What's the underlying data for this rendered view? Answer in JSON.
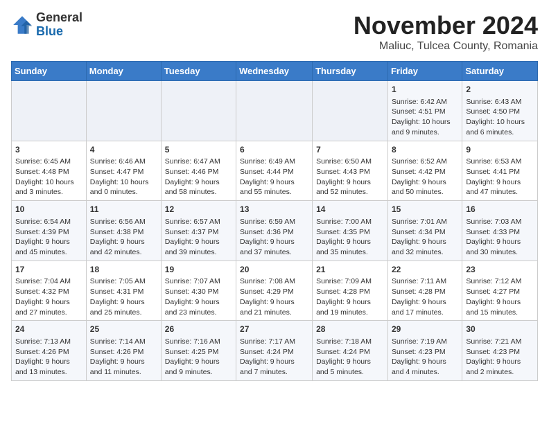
{
  "logo": {
    "general": "General",
    "blue": "Blue"
  },
  "title": "November 2024",
  "location": "Maliuc, Tulcea County, Romania",
  "days_of_week": [
    "Sunday",
    "Monday",
    "Tuesday",
    "Wednesday",
    "Thursday",
    "Friday",
    "Saturday"
  ],
  "weeks": [
    [
      {
        "day": "",
        "sunrise": "",
        "sunset": "",
        "daylight": ""
      },
      {
        "day": "",
        "sunrise": "",
        "sunset": "",
        "daylight": ""
      },
      {
        "day": "",
        "sunrise": "",
        "sunset": "",
        "daylight": ""
      },
      {
        "day": "",
        "sunrise": "",
        "sunset": "",
        "daylight": ""
      },
      {
        "day": "",
        "sunrise": "",
        "sunset": "",
        "daylight": ""
      },
      {
        "day": "1",
        "sunrise": "Sunrise: 6:42 AM",
        "sunset": "Sunset: 4:51 PM",
        "daylight": "Daylight: 10 hours and 9 minutes."
      },
      {
        "day": "2",
        "sunrise": "Sunrise: 6:43 AM",
        "sunset": "Sunset: 4:50 PM",
        "daylight": "Daylight: 10 hours and 6 minutes."
      }
    ],
    [
      {
        "day": "3",
        "sunrise": "Sunrise: 6:45 AM",
        "sunset": "Sunset: 4:48 PM",
        "daylight": "Daylight: 10 hours and 3 minutes."
      },
      {
        "day": "4",
        "sunrise": "Sunrise: 6:46 AM",
        "sunset": "Sunset: 4:47 PM",
        "daylight": "Daylight: 10 hours and 0 minutes."
      },
      {
        "day": "5",
        "sunrise": "Sunrise: 6:47 AM",
        "sunset": "Sunset: 4:46 PM",
        "daylight": "Daylight: 9 hours and 58 minutes."
      },
      {
        "day": "6",
        "sunrise": "Sunrise: 6:49 AM",
        "sunset": "Sunset: 4:44 PM",
        "daylight": "Daylight: 9 hours and 55 minutes."
      },
      {
        "day": "7",
        "sunrise": "Sunrise: 6:50 AM",
        "sunset": "Sunset: 4:43 PM",
        "daylight": "Daylight: 9 hours and 52 minutes."
      },
      {
        "day": "8",
        "sunrise": "Sunrise: 6:52 AM",
        "sunset": "Sunset: 4:42 PM",
        "daylight": "Daylight: 9 hours and 50 minutes."
      },
      {
        "day": "9",
        "sunrise": "Sunrise: 6:53 AM",
        "sunset": "Sunset: 4:41 PM",
        "daylight": "Daylight: 9 hours and 47 minutes."
      }
    ],
    [
      {
        "day": "10",
        "sunrise": "Sunrise: 6:54 AM",
        "sunset": "Sunset: 4:39 PM",
        "daylight": "Daylight: 9 hours and 45 minutes."
      },
      {
        "day": "11",
        "sunrise": "Sunrise: 6:56 AM",
        "sunset": "Sunset: 4:38 PM",
        "daylight": "Daylight: 9 hours and 42 minutes."
      },
      {
        "day": "12",
        "sunrise": "Sunrise: 6:57 AM",
        "sunset": "Sunset: 4:37 PM",
        "daylight": "Daylight: 9 hours and 39 minutes."
      },
      {
        "day": "13",
        "sunrise": "Sunrise: 6:59 AM",
        "sunset": "Sunset: 4:36 PM",
        "daylight": "Daylight: 9 hours and 37 minutes."
      },
      {
        "day": "14",
        "sunrise": "Sunrise: 7:00 AM",
        "sunset": "Sunset: 4:35 PM",
        "daylight": "Daylight: 9 hours and 35 minutes."
      },
      {
        "day": "15",
        "sunrise": "Sunrise: 7:01 AM",
        "sunset": "Sunset: 4:34 PM",
        "daylight": "Daylight: 9 hours and 32 minutes."
      },
      {
        "day": "16",
        "sunrise": "Sunrise: 7:03 AM",
        "sunset": "Sunset: 4:33 PM",
        "daylight": "Daylight: 9 hours and 30 minutes."
      }
    ],
    [
      {
        "day": "17",
        "sunrise": "Sunrise: 7:04 AM",
        "sunset": "Sunset: 4:32 PM",
        "daylight": "Daylight: 9 hours and 27 minutes."
      },
      {
        "day": "18",
        "sunrise": "Sunrise: 7:05 AM",
        "sunset": "Sunset: 4:31 PM",
        "daylight": "Daylight: 9 hours and 25 minutes."
      },
      {
        "day": "19",
        "sunrise": "Sunrise: 7:07 AM",
        "sunset": "Sunset: 4:30 PM",
        "daylight": "Daylight: 9 hours and 23 minutes."
      },
      {
        "day": "20",
        "sunrise": "Sunrise: 7:08 AM",
        "sunset": "Sunset: 4:29 PM",
        "daylight": "Daylight: 9 hours and 21 minutes."
      },
      {
        "day": "21",
        "sunrise": "Sunrise: 7:09 AM",
        "sunset": "Sunset: 4:28 PM",
        "daylight": "Daylight: 9 hours and 19 minutes."
      },
      {
        "day": "22",
        "sunrise": "Sunrise: 7:11 AM",
        "sunset": "Sunset: 4:28 PM",
        "daylight": "Daylight: 9 hours and 17 minutes."
      },
      {
        "day": "23",
        "sunrise": "Sunrise: 7:12 AM",
        "sunset": "Sunset: 4:27 PM",
        "daylight": "Daylight: 9 hours and 15 minutes."
      }
    ],
    [
      {
        "day": "24",
        "sunrise": "Sunrise: 7:13 AM",
        "sunset": "Sunset: 4:26 PM",
        "daylight": "Daylight: 9 hours and 13 minutes."
      },
      {
        "day": "25",
        "sunrise": "Sunrise: 7:14 AM",
        "sunset": "Sunset: 4:26 PM",
        "daylight": "Daylight: 9 hours and 11 minutes."
      },
      {
        "day": "26",
        "sunrise": "Sunrise: 7:16 AM",
        "sunset": "Sunset: 4:25 PM",
        "daylight": "Daylight: 9 hours and 9 minutes."
      },
      {
        "day": "27",
        "sunrise": "Sunrise: 7:17 AM",
        "sunset": "Sunset: 4:24 PM",
        "daylight": "Daylight: 9 hours and 7 minutes."
      },
      {
        "day": "28",
        "sunrise": "Sunrise: 7:18 AM",
        "sunset": "Sunset: 4:24 PM",
        "daylight": "Daylight: 9 hours and 5 minutes."
      },
      {
        "day": "29",
        "sunrise": "Sunrise: 7:19 AM",
        "sunset": "Sunset: 4:23 PM",
        "daylight": "Daylight: 9 hours and 4 minutes."
      },
      {
        "day": "30",
        "sunrise": "Sunrise: 7:21 AM",
        "sunset": "Sunset: 4:23 PM",
        "daylight": "Daylight: 9 hours and 2 minutes."
      }
    ]
  ]
}
